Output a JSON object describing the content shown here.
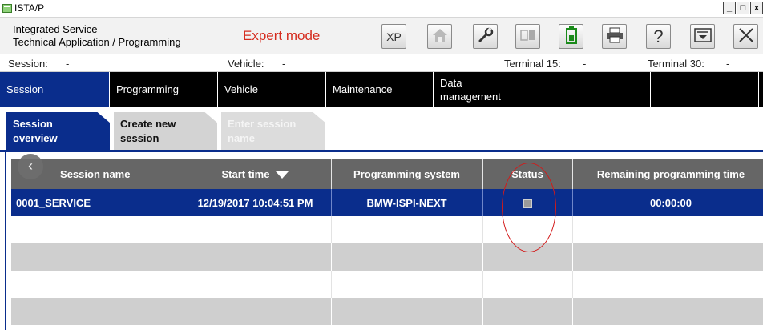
{
  "window": {
    "title": "ISTA/P",
    "controls": [
      "_",
      "□",
      "x"
    ]
  },
  "header": {
    "brand_line1": "Integrated Service",
    "brand_line2": "Technical Application / Programming",
    "mode": "Expert mode",
    "mode_color": "#d52b1e",
    "toolbar": [
      {
        "name": "xp-button",
        "label": "XP"
      },
      {
        "name": "home-button",
        "icon": "home-icon"
      },
      {
        "name": "wrench-button",
        "icon": "wrench-icon"
      },
      {
        "name": "window-button",
        "icon": "window-icon"
      },
      {
        "name": "battery-button",
        "icon": "battery-icon"
      },
      {
        "name": "print-button",
        "icon": "printer-icon"
      },
      {
        "name": "help-button",
        "icon": "question-icon",
        "label": "?"
      },
      {
        "name": "minimize-panel-button",
        "icon": "minimize-icon"
      },
      {
        "name": "close-app-button",
        "icon": "close-icon"
      }
    ]
  },
  "statusline": {
    "session_label": "Session:",
    "session_value": "-",
    "vehicle_label": "Vehicle:",
    "vehicle_value": "-",
    "terminal15_label": "Terminal 15:",
    "terminal15_value": "-",
    "terminal30_label": "Terminal 30:",
    "terminal30_value": "-"
  },
  "mainnav": {
    "items": [
      "Session",
      "Programming",
      "Vehicle",
      "Maintenance",
      "Data management"
    ],
    "active": "Session",
    "accent": "#0a2d8c"
  },
  "subnav": {
    "tabs": [
      {
        "label": "Session overview",
        "state": "active"
      },
      {
        "label": "Create new session",
        "state": "normal"
      },
      {
        "label": "Enter session name",
        "state": "disabled"
      }
    ]
  },
  "table": {
    "columns": [
      "Session name",
      "Start time",
      "Programming system",
      "Status",
      "Remaining programming time"
    ],
    "sorted_column": "Start time",
    "sort_direction": "descending",
    "rows": [
      {
        "session_name": "0001_SERVICE",
        "start_time": "12/19/2017 10:04:51 PM",
        "programming_system": "BMW-ISPI-NEXT",
        "status": "grey square",
        "remaining_time": "00:00:00"
      }
    ],
    "selected_row_color": "#0a2d8c"
  }
}
